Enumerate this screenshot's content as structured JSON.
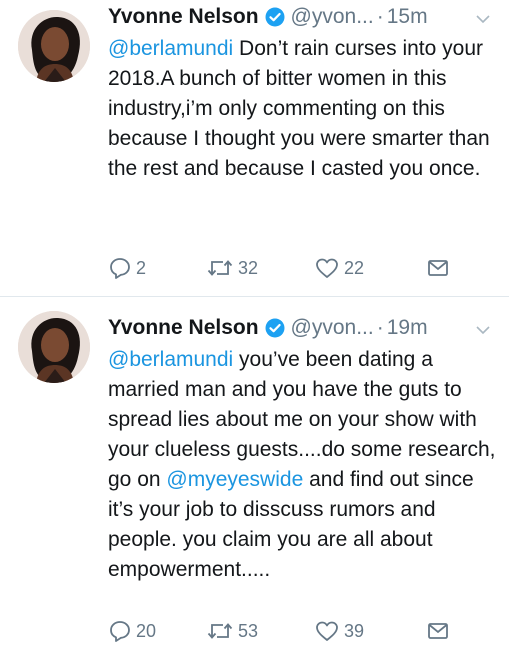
{
  "tweets": [
    {
      "name": "Yvonne Nelson",
      "handle": "@yvon...",
      "time": "15m",
      "dot": "·",
      "mention": "@berlamundi",
      "text": " Don’t rain curses into your 2018.A bunch of bitter women in this industry,i’m only commenting on this because I thought you were smarter than the rest and because I casted you once.",
      "replies": "2",
      "retweets": "32",
      "likes": "22"
    },
    {
      "name": "Yvonne Nelson",
      "handle": "@yvon...",
      "time": "19m",
      "dot": "·",
      "mention": "@berlamundi",
      "text_part1": " you’ve been dating a married man and you have the guts to spread lies about me on your show with your clueless guests....do some research, go on ",
      "mention2": "@myeyeswide",
      "text_part2": " and find out since it’s your job to disscuss rumors and people. you claim you are all about empowerment.....",
      "replies": "20",
      "retweets": "53",
      "likes": "39"
    }
  ],
  "colors": {
    "link": "#1b95e0",
    "secondary": "#657786",
    "verified": "#1da1f2"
  },
  "icons": [
    "avatar",
    "verified-badge-icon",
    "caret-down-icon",
    "reply-icon",
    "retweet-icon",
    "like-icon",
    "direct-message-icon"
  ]
}
